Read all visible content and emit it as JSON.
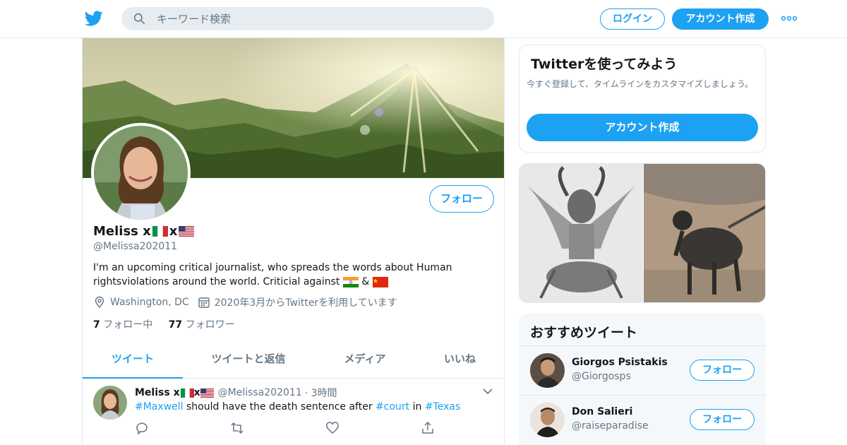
{
  "header": {
    "search_placeholder": "キーワード検索",
    "login_label": "ログイン",
    "signup_label": "アカウント作成"
  },
  "profile": {
    "name": "Meliss x",
    "name_sep": "x",
    "handle": "@Melissa202011",
    "bio_line1": "I'm an upcoming critical journalist, who spreads the words about Human",
    "bio_line2": "rightsviolations around the world. Criticial against",
    "bio_amp": "&",
    "location": "Washington, DC",
    "joined": "2020年3月からTwitterを利用しています",
    "following_count": "7",
    "following_label": "フォロー中",
    "followers_count": "77",
    "followers_label": "フォロワー",
    "follow_label": "フォロー"
  },
  "tabs": [
    {
      "label": "ツイート"
    },
    {
      "label": "ツイートと返信"
    },
    {
      "label": "メディア"
    },
    {
      "label": "いいね"
    }
  ],
  "tweet": {
    "name": "Meliss x",
    "name_sep": "x",
    "handle": "@Melissa202011",
    "time": "· 3時間",
    "tag1": "#Maxwell",
    "text1": " should have the death sentence after ",
    "tag2": "#court",
    "text2": " in ",
    "tag3": "#Texas"
  },
  "join_card": {
    "title": "Twitterを使ってみよう",
    "desc": "今すぐ登録して、タイムラインをカスタマイズしましょう。",
    "cta": "アカウント作成"
  },
  "recommend": {
    "title": "おすすめツイート",
    "users": [
      {
        "name": "Giorgos Psistakis",
        "handle": "@Giorgosps",
        "follow": "フォロー"
      },
      {
        "name": "Don Salieri",
        "handle": "@raiseparadise",
        "follow": "フォロー"
      }
    ]
  },
  "colors": {
    "accent": "#1da1f2",
    "secondary_text": "#657786",
    "border": "#e1e8ed"
  },
  "icons": [
    "twitter-bird-icon",
    "search-icon",
    "more-dots-icon",
    "location-icon",
    "calendar-icon",
    "reply-icon",
    "retweet-icon",
    "like-icon",
    "share-icon",
    "chevron-down-icon"
  ]
}
